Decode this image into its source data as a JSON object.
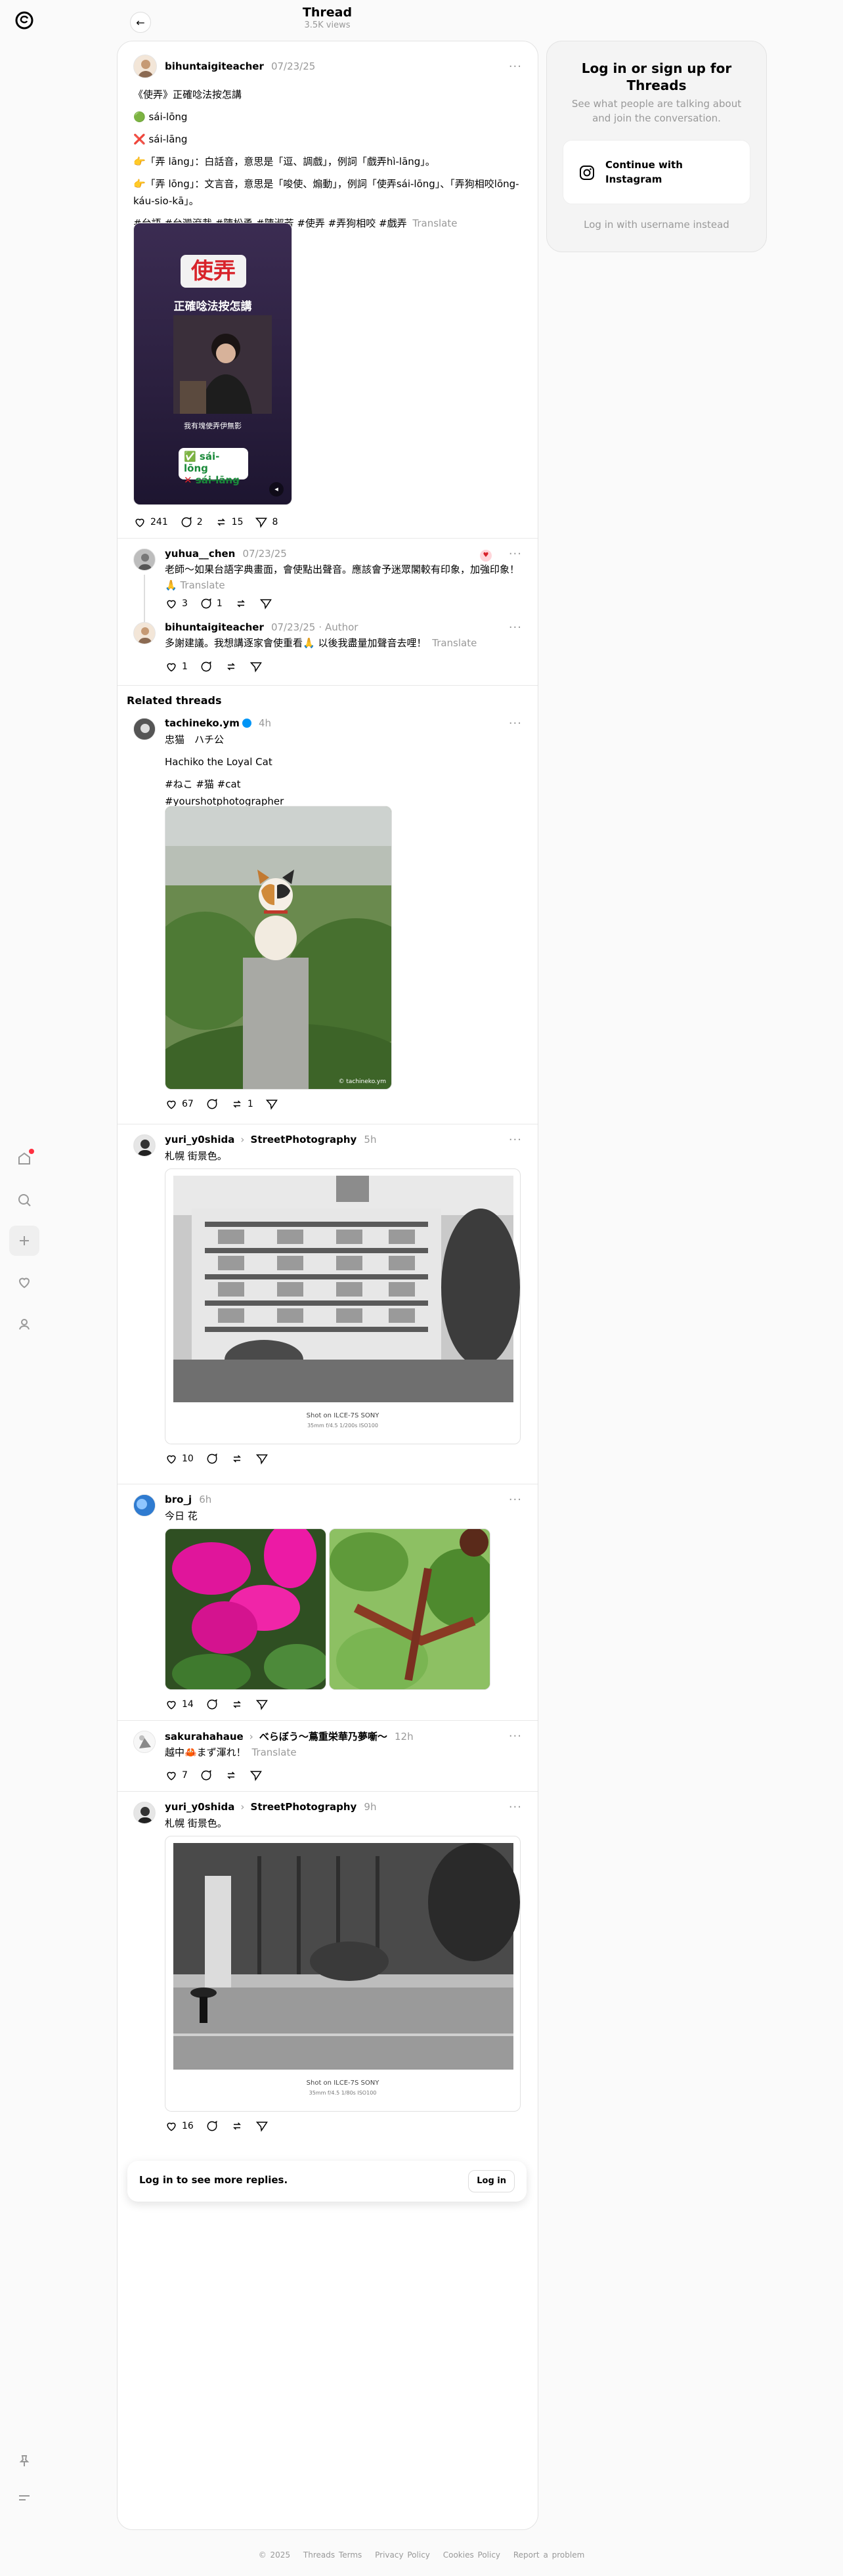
{
  "header": {
    "title": "Thread",
    "views": "3.5K views"
  },
  "rail": {
    "logo_icon": "threads-logo-icon",
    "notify_color": "#ff3040"
  },
  "post": {
    "username": "bihuntaigiteacher",
    "date": "07/23/25",
    "lines": [
      "《使弄》正確唸法按怎講",
      "🟢 sái-lōng",
      "❌ sái-lāng",
      "👉「弄 lāng」：白話音，意思是「逗、調戲」，例詞「戲弄hì-lāng」。",
      "👉「弄 lōng」：文言音，意思是「唆使、煽動」，例詞「使弄sái-lōng」、「弄狗相咬lōng-káu-sio-kā」。"
    ],
    "tags": "#台語 #台灣滾裁 #陳松勇 #陳淑芳 #使弄 #弄狗相咬 #戲弄",
    "translate": "Translate",
    "image": {
      "big_char": "使弄",
      "subtitle": "正確唸法按怎講",
      "caption": "我有塊使弄伊無影",
      "correct": "sái-lōng",
      "wrong": "sái-lāng"
    },
    "likes": "241",
    "replies": "2",
    "reposts": "15",
    "shares": "8"
  },
  "replies": [
    {
      "username": "yuhua__chen",
      "date": "07/23/25",
      "text": "老師～如果台語字典畫面，會使點出聲音。應該會予迷眾閣較有印象，加強印象！🙏",
      "translate": "Translate",
      "likes": "3",
      "replies": "1"
    },
    {
      "username": "bihuntaigiteacher",
      "date": "07/23/25",
      "author": "Author",
      "text": "多謝建議。我想講逐家會使重看🙏 以後我盡量加聲音去哩！",
      "translate": "Translate",
      "likes": "1"
    }
  ],
  "related": {
    "title": "Related threads",
    "items": [
      {
        "username": "tachineko.ym",
        "time": "4h",
        "lines": [
          "忠猫　ハチ公",
          "Hachiko the Loyal Cat",
          "#ねこ #猫 #cat",
          "#yourshotphotographer"
        ],
        "likes": "67",
        "reposts": "1",
        "watermark": "© tachineko.ym"
      },
      {
        "username": "yuri_y0shida",
        "community": "StreetPhotography",
        "time": "5h",
        "text": "札幌 街景色。",
        "likes": "10",
        "photo_caption": "Shot on ILCE-7S SONY",
        "photo_exif": "35mm  f/4.5  1/200s  ISO100"
      },
      {
        "username": "bro_j",
        "time": "6h",
        "text": "今日 花",
        "likes": "14"
      },
      {
        "username": "sakurahahaue",
        "community": "べらぼう〜蔦重栄華乃夢噺〜",
        "time": "12h",
        "text": "越中🦀まず渾れ！",
        "translate": "Translate",
        "likes": "7"
      },
      {
        "username": "yuri_y0shida",
        "community": "StreetPhotography",
        "time": "9h",
        "text": "札幌 街景色。",
        "likes": "16",
        "photo_caption": "Shot on ILCE-7S SONY",
        "photo_exif": "35mm  f/4.5  1/80s  ISO100"
      }
    ]
  },
  "login_banner": {
    "text": "Log in to see more replies.",
    "button": "Log in"
  },
  "sidebar": {
    "title": "Log in or sign up for Threads",
    "subtitle": "See what people are talking about and join the conversation.",
    "instagram_button": "Continue with Instagram",
    "alt_login": "Log in with username instead"
  },
  "footer": {
    "copyright": "© 2025",
    "terms": "Threads Terms",
    "privacy": "Privacy Policy",
    "cookies": "Cookies Policy",
    "report": "Report a problem"
  }
}
